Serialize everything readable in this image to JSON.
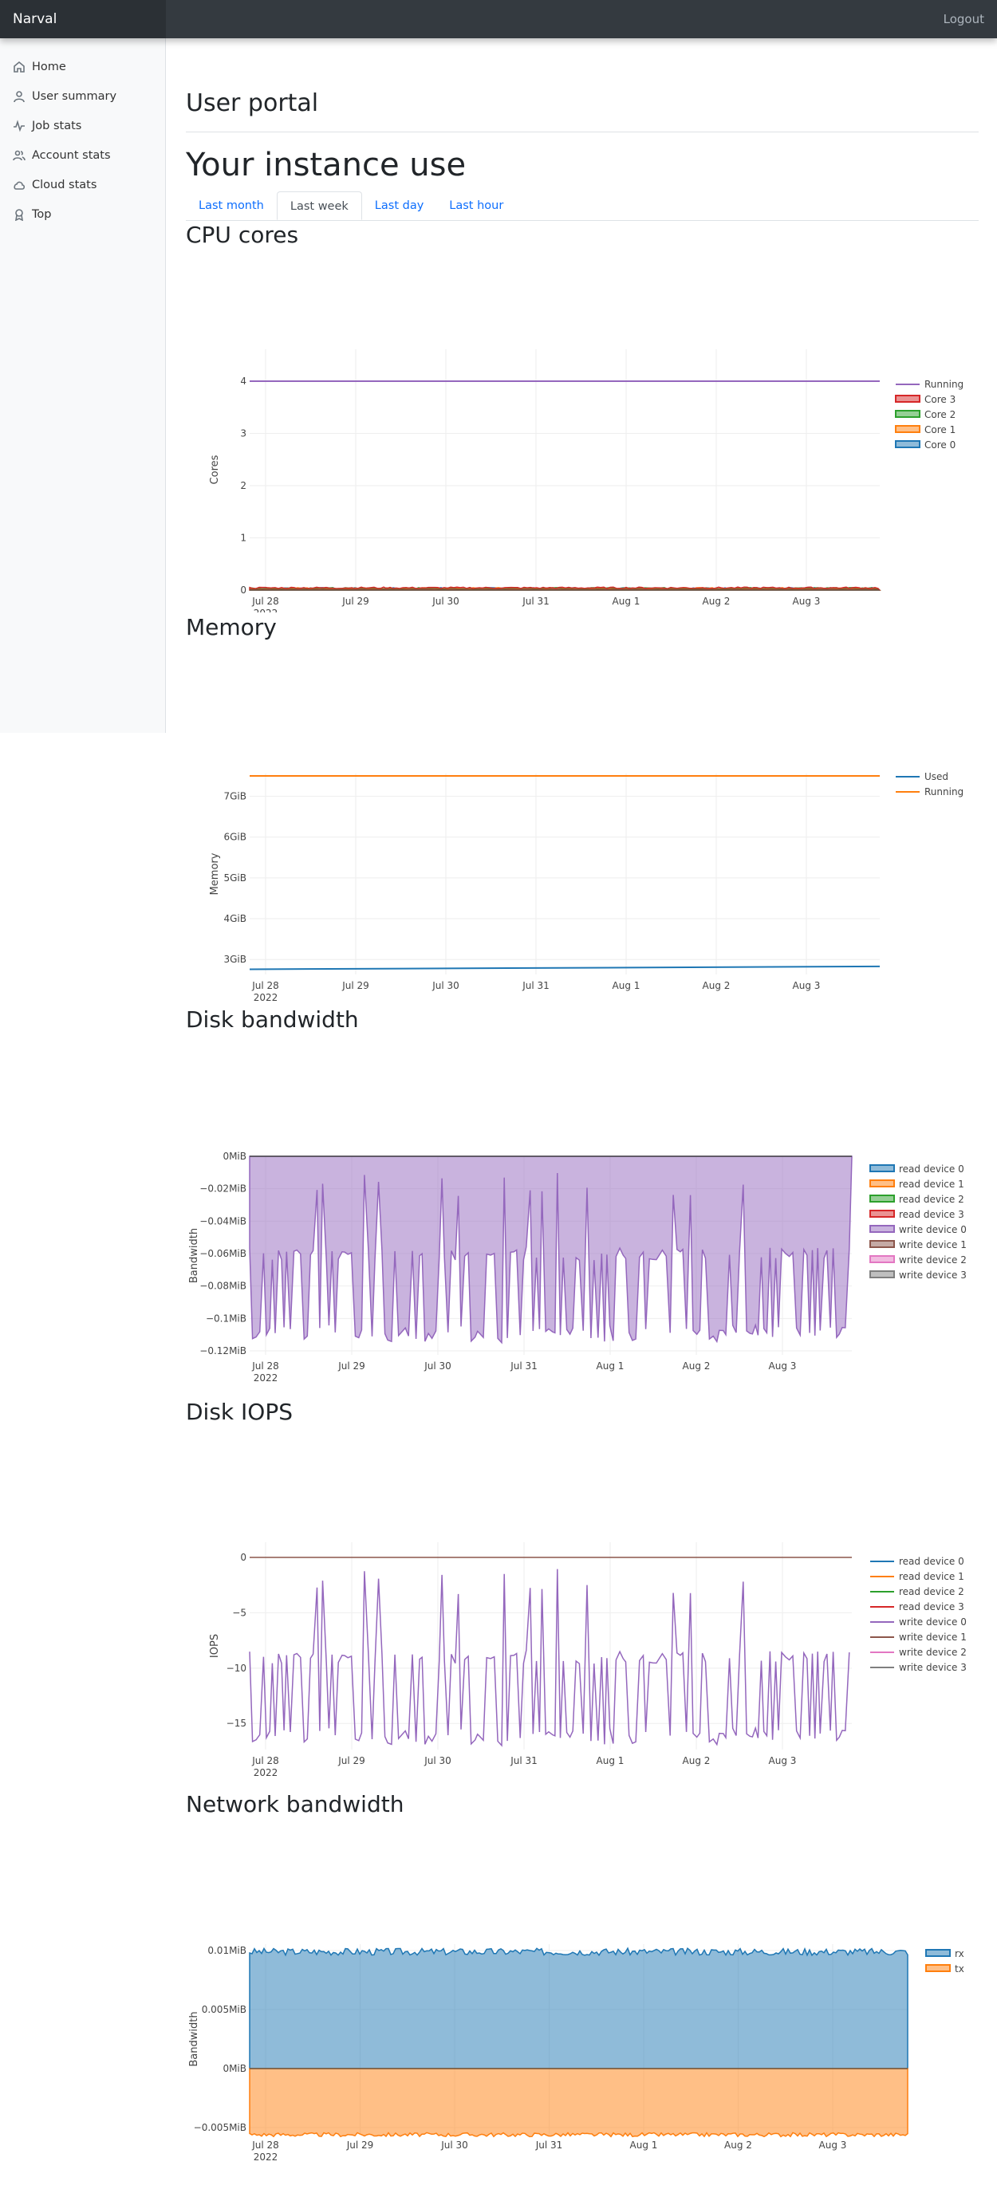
{
  "app": {
    "brand": "Narval",
    "logout": "Logout"
  },
  "sidebar": {
    "items": [
      {
        "label": "Home",
        "icon": "home-icon"
      },
      {
        "label": "User summary",
        "icon": "user-icon"
      },
      {
        "label": "Job stats",
        "icon": "activity-icon"
      },
      {
        "label": "Account stats",
        "icon": "users-icon"
      },
      {
        "label": "Cloud stats",
        "icon": "cloud-icon"
      },
      {
        "label": "Top",
        "icon": "award-icon"
      }
    ]
  },
  "page": {
    "title": "User portal",
    "subtitle": "Your instance use"
  },
  "tabs": [
    {
      "label": "Last month",
      "active": false
    },
    {
      "label": "Last week",
      "active": true
    },
    {
      "label": "Last day",
      "active": false
    },
    {
      "label": "Last hour",
      "active": false
    }
  ],
  "sections": {
    "cpu": "CPU cores",
    "memory": "Memory",
    "disk_bw": "Disk bandwidth",
    "disk_iops": "Disk IOPS",
    "net_bw": "Network bandwidth"
  },
  "colors": {
    "blue": "#1f77b4",
    "orange": "#ff7f0e",
    "green": "#2ca02c",
    "red": "#d62728",
    "purple": "#9467bd",
    "brown": "#8c564b",
    "pink": "#e377c2",
    "gray": "#7f7f7f"
  },
  "chart_data": [
    {
      "id": "cpu",
      "type": "line",
      "title": "",
      "xlabel": "",
      "ylabel": "Cores",
      "x_ticks": [
        "Jul 28",
        "Jul 29",
        "Jul 30",
        "Jul 31",
        "Aug 1",
        "Aug 2",
        "Aug 3"
      ],
      "x_year": "2022",
      "x_range": [
        "2022-07-27 23:00",
        "2022-08-03 19:00"
      ],
      "y_range": [
        0,
        4
      ],
      "y_ticks": [
        0,
        1,
        2,
        3,
        4
      ],
      "y_tick_labels": [
        "0",
        "1",
        "2",
        "3",
        "4"
      ],
      "series": [
        {
          "name": "Running",
          "value": 4,
          "color": "#9467bd",
          "style": "line"
        },
        {
          "name": "Core 3",
          "value": 0.03,
          "color": "#d62728",
          "style": "area"
        },
        {
          "name": "Core 2",
          "value": 0.02,
          "color": "#2ca02c",
          "style": "area"
        },
        {
          "name": "Core 1",
          "value": 0.02,
          "color": "#ff7f0e",
          "style": "area"
        },
        {
          "name": "Core 0",
          "value": 0.02,
          "color": "#1f77b4",
          "style": "area"
        }
      ]
    },
    {
      "id": "memory",
      "type": "line",
      "title": "",
      "xlabel": "",
      "ylabel": "Memory",
      "x_ticks": [
        "Jul 28",
        "Jul 29",
        "Jul 30",
        "Jul 31",
        "Aug 1",
        "Aug 2",
        "Aug 3"
      ],
      "x_year": "2022",
      "y_range": [
        2.75,
        7.5
      ],
      "y_ticks": [
        3,
        4,
        5,
        6,
        7
      ],
      "y_tick_labels": [
        "3GiB",
        "4GiB",
        "5GiB",
        "6GiB",
        "7GiB"
      ],
      "series": [
        {
          "name": "Used",
          "start": 2.76,
          "end": 2.83,
          "color": "#1f77b4"
        },
        {
          "name": "Running",
          "value": 7.5,
          "color": "#ff7f0e"
        }
      ]
    },
    {
      "id": "disk_bw",
      "type": "area",
      "title": "",
      "xlabel": "",
      "ylabel": "Bandwidth",
      "x_ticks": [
        "Jul 28",
        "Jul 29",
        "Jul 30",
        "Jul 31",
        "Aug 1",
        "Aug 2",
        "Aug 3"
      ],
      "x_year": "2022",
      "y_range": [
        -0.12,
        0
      ],
      "y_ticks": [
        0,
        -0.02,
        -0.04,
        -0.06,
        -0.08,
        -0.1,
        -0.12
      ],
      "y_tick_labels": [
        "0MiB",
        "−0.02MiB",
        "−0.04MiB",
        "−0.06MiB",
        "−0.08MiB",
        "−0.1MiB",
        "−0.12MiB"
      ],
      "legend": [
        "read device 0",
        "read device 1",
        "read device 2",
        "read device 3",
        "write device 0",
        "write device 1",
        "write device 2",
        "write device 3"
      ],
      "legend_colors": [
        "#1f77b4",
        "#ff7f0e",
        "#2ca02c",
        "#d62728",
        "#9467bd",
        "#8c564b",
        "#e377c2",
        "#7f7f7f"
      ],
      "active_series": "write device 0",
      "typical_range": [
        -0.115,
        -0.06
      ],
      "spike_min": -0.01
    },
    {
      "id": "disk_iops",
      "type": "line",
      "title": "",
      "xlabel": "",
      "ylabel": "IOPS",
      "x_ticks": [
        "Jul 28",
        "Jul 29",
        "Jul 30",
        "Jul 31",
        "Aug 1",
        "Aug 2",
        "Aug 3"
      ],
      "x_year": "2022",
      "y_range": [
        -18,
        0.5
      ],
      "y_ticks": [
        0,
        -5,
        -10,
        -15
      ],
      "y_tick_labels": [
        "0",
        "−5",
        "−10",
        "−15"
      ],
      "legend": [
        "read device 0",
        "read device 1",
        "read device 2",
        "read device 3",
        "write device 0",
        "write device 1",
        "write device 2",
        "write device 3"
      ],
      "legend_colors": [
        "#1f77b4",
        "#ff7f0e",
        "#2ca02c",
        "#d62728",
        "#9467bd",
        "#8c564b",
        "#e377c2",
        "#7f7f7f"
      ],
      "active_series": "write device 0",
      "typical_range": [
        -17,
        -9
      ],
      "spike_min": -1
    },
    {
      "id": "net_bw",
      "type": "area",
      "title": "",
      "xlabel": "",
      "ylabel": "Bandwidth",
      "x_ticks": [
        "Jul 28",
        "Jul 29",
        "Jul 30",
        "Jul 31",
        "Aug 1",
        "Aug 2",
        "Aug 3"
      ],
      "x_year": "2022",
      "y_range": [
        -0.0065,
        0.0105
      ],
      "y_ticks": [
        0.01,
        0.005,
        0,
        -0.005
      ],
      "y_tick_labels": [
        "0.01MiB",
        "0.005MiB",
        "0MiB",
        "−0.005MiB"
      ],
      "series": [
        {
          "name": "rx",
          "mean": 0.0099,
          "color": "#1f77b4"
        },
        {
          "name": "tx",
          "mean": -0.0056,
          "color": "#ff7f0e"
        }
      ]
    }
  ]
}
